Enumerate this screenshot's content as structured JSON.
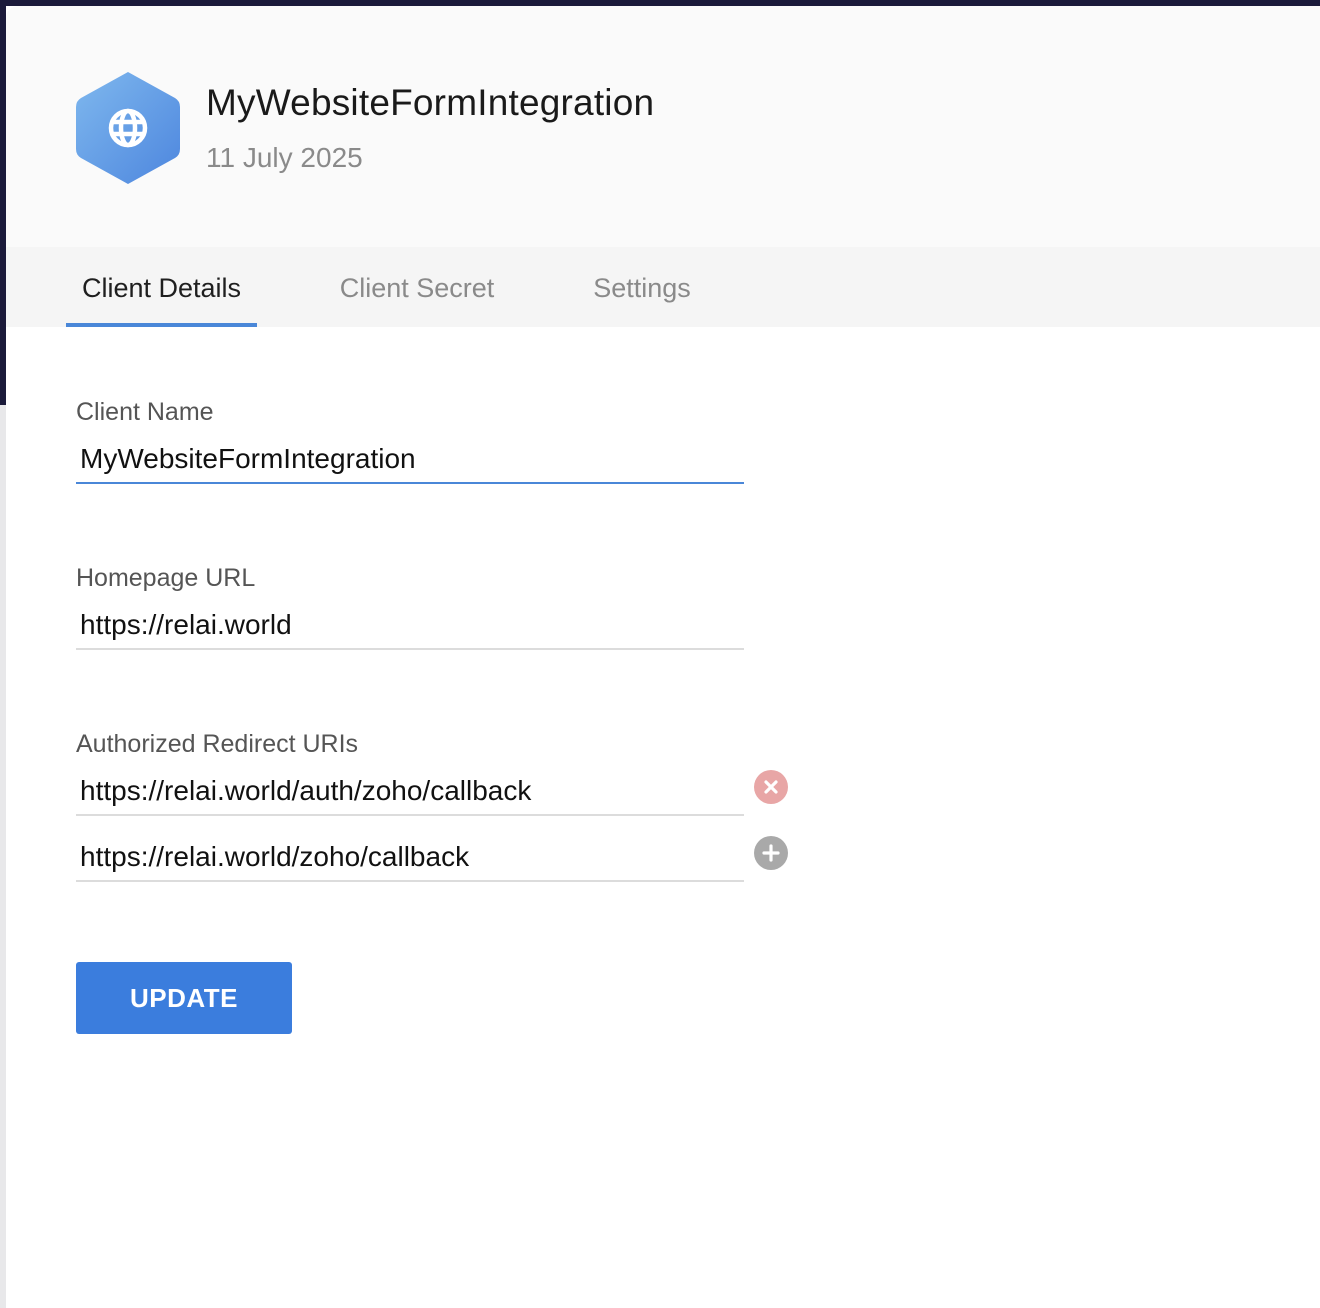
{
  "app": {
    "icon": "globe-icon",
    "title": "MyWebsiteFormIntegration",
    "date": "11 July 2025",
    "colors": {
      "icon_gradient_start": "#7fb8ee",
      "icon_gradient_end": "#4d86de",
      "accent": "#4a87d8",
      "button": "#3b7ddd",
      "remove": "#e8a6a6",
      "add": "#a9a9a9"
    }
  },
  "tabs": [
    {
      "label": "Client Details",
      "active": true
    },
    {
      "label": "Client Secret",
      "active": false
    },
    {
      "label": "Settings",
      "active": false
    }
  ],
  "form": {
    "client_name": {
      "label": "Client Name",
      "value": "MyWebsiteFormIntegration"
    },
    "homepage_url": {
      "label": "Homepage URL",
      "value": "https://relai.world"
    },
    "redirect_uris": {
      "label": "Authorized Redirect URIs",
      "items": [
        {
          "value": "https://relai.world/auth/zoho/callback",
          "action_icon": "remove-icon"
        },
        {
          "value": "https://relai.world/zoho/callback",
          "action_icon": "add-icon"
        }
      ]
    },
    "update_label": "UPDATE"
  }
}
